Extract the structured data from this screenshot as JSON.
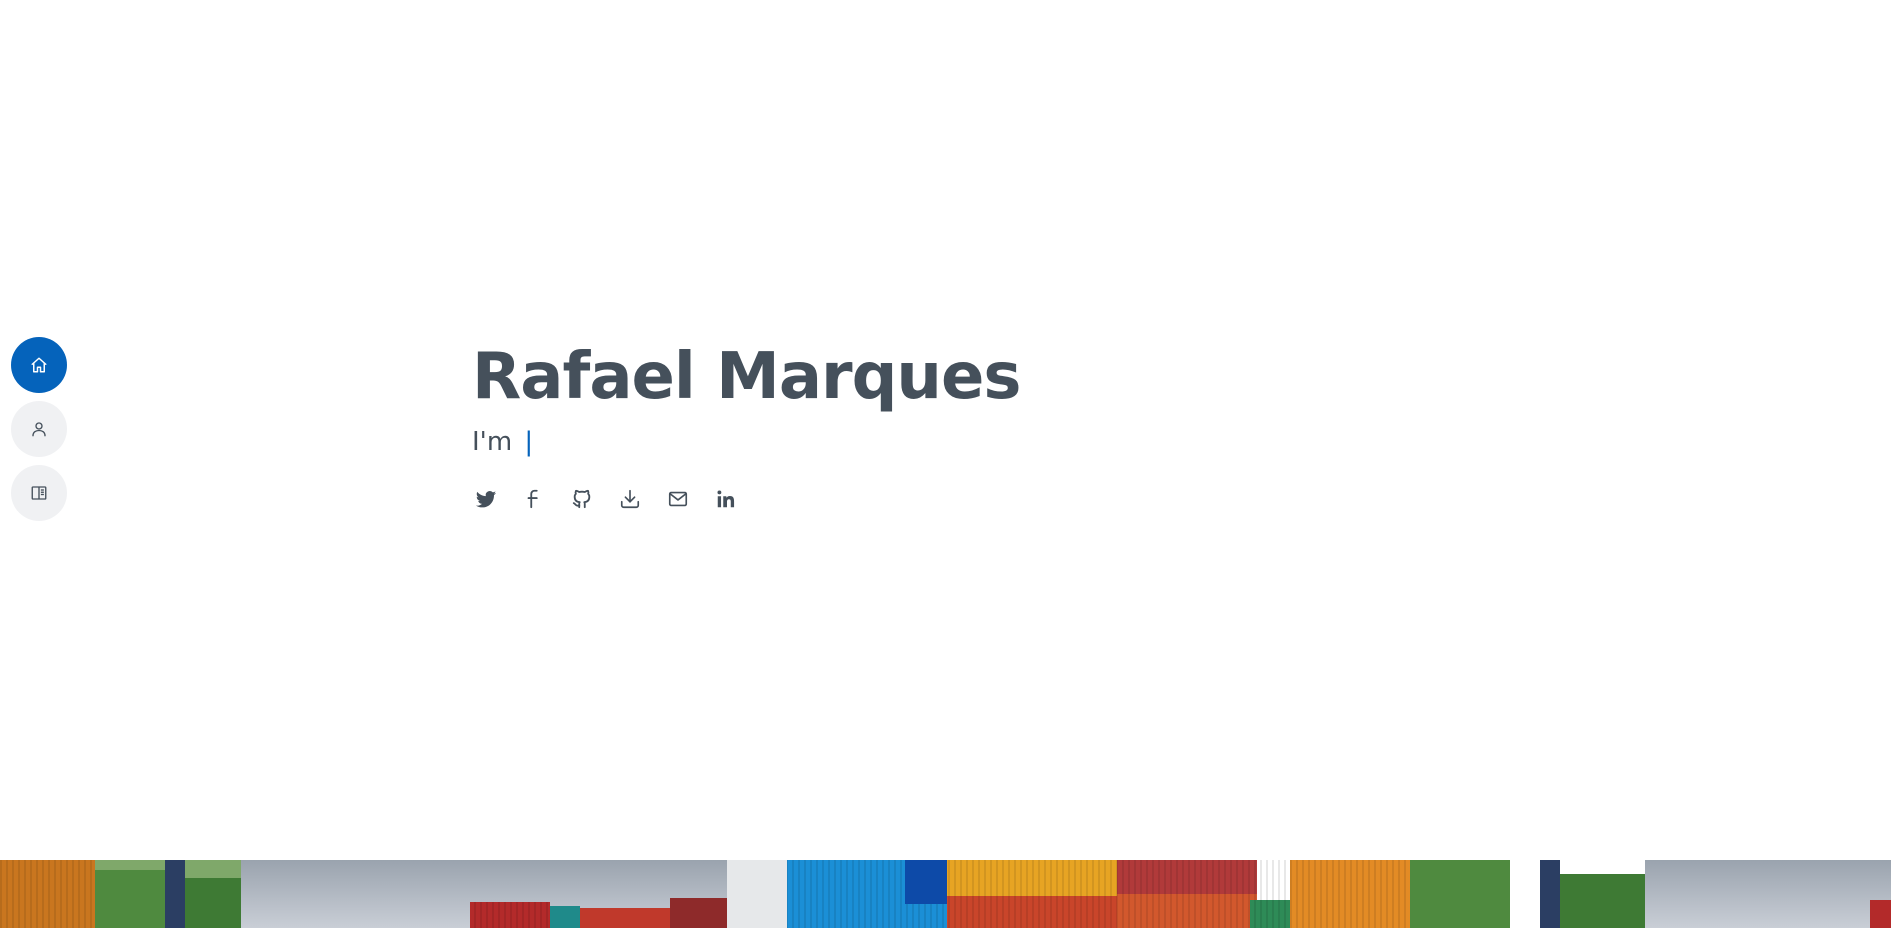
{
  "nav": {
    "items": [
      {
        "name": "home",
        "icon": "home-icon",
        "active": true
      },
      {
        "name": "about",
        "icon": "person-icon",
        "active": false
      },
      {
        "name": "resume",
        "icon": "book-icon",
        "active": false
      }
    ]
  },
  "hero": {
    "name": "Rafael Marques",
    "subtitle_prefix": "I'm",
    "cursor": "|"
  },
  "socials": [
    {
      "name": "twitter",
      "icon": "twitter-icon"
    },
    {
      "name": "facebook",
      "icon": "facebook-icon"
    },
    {
      "name": "github",
      "icon": "github-icon"
    },
    {
      "name": "download",
      "icon": "download-icon"
    },
    {
      "name": "email",
      "icon": "envelope-icon"
    },
    {
      "name": "linkedin",
      "icon": "linkedin-icon"
    }
  ],
  "colors": {
    "accent": "#0563bb",
    "text": "#45505b",
    "nav_inactive": "#f0f1f3"
  },
  "background_image": "shipping-containers-photo"
}
